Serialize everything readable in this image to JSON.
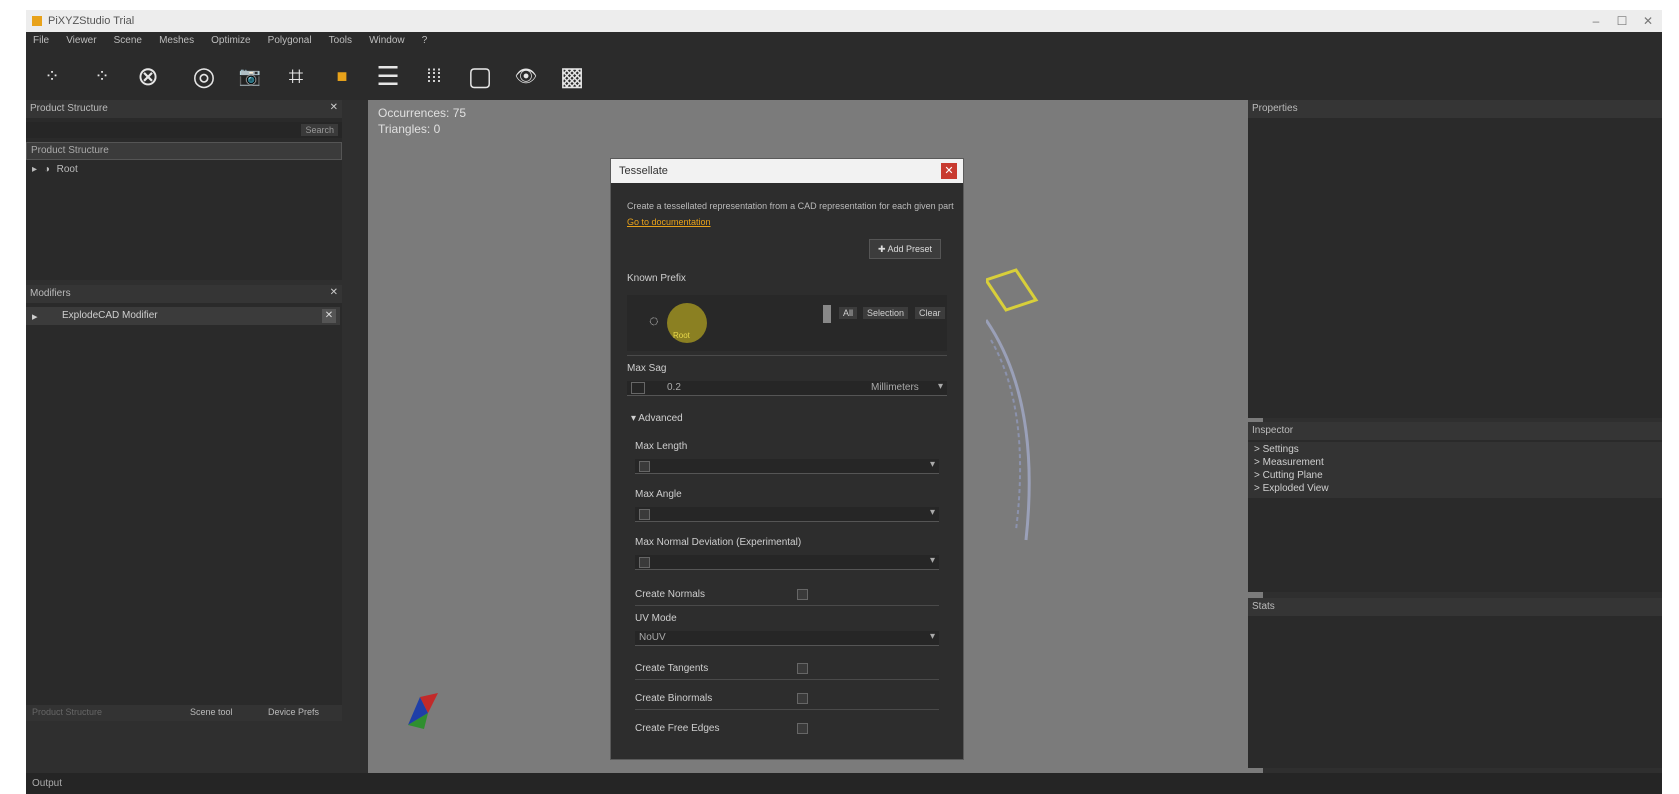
{
  "window": {
    "title": "PiXYZStudio Trial",
    "controls": [
      "‒",
      "☐",
      "✕"
    ]
  },
  "menu": [
    "File",
    "Viewer",
    "Scene",
    "Meshes",
    "Optimize",
    "Polygonal",
    "Tools",
    "Window",
    "?"
  ],
  "toolbar": [
    {
      "icon": "overlap-node-icon",
      "glyph": "⁘"
    },
    {
      "icon": "overlap-arrow-icon",
      "glyph": "⁘"
    },
    {
      "icon": "close-circle-icon",
      "glyph": "⊗"
    },
    {
      "icon": "fit-view-icon",
      "glyph": "◎"
    },
    {
      "icon": "camera-icon",
      "glyph": "📷"
    },
    {
      "icon": "crop-icon",
      "glyph": "⌗"
    },
    {
      "icon": "solid-square-icon",
      "glyph": "■"
    },
    {
      "icon": "lines-icon",
      "glyph": "☰"
    },
    {
      "icon": "grid-dots-icon",
      "glyph": "⁞⁞⁞"
    },
    {
      "icon": "square-outline-icon",
      "glyph": "▢"
    },
    {
      "icon": "eye-icon",
      "glyph": "👁"
    },
    {
      "icon": "checker-icon",
      "glyph": "▩"
    }
  ],
  "colors": {
    "accent": "#e8a21a",
    "close": "#c83a2f",
    "link": "#e8a21a"
  },
  "product_structure": {
    "title": "Product Structure",
    "search_label": "Search",
    "header": "Product Structure",
    "root": "Root"
  },
  "modifiers": {
    "title": "Modifiers",
    "item": "ExplodeCAD Modifier"
  },
  "left_bottom_tabs": [
    "Product Structure",
    "Scene tool",
    "Device Prefs"
  ],
  "viewport": {
    "occurrences": "Occurrences: 75",
    "triangles": "Triangles: 0"
  },
  "dialog": {
    "title": "Tessellate",
    "description": "Create a tessellated representation from a CAD representation for each given part",
    "doc_link": "Go to documentation",
    "add_preset": "Add Preset",
    "section_prefix": "Known Prefix",
    "thumb_label": "Root",
    "btn_a": "All",
    "btn_b": "Selection",
    "btn_c": "Clear",
    "max_sag": "Max Sag",
    "max_sag_value": "0.2",
    "max_sag_unit": "Millimeters",
    "advanced": "Advanced",
    "max_length": "Max Length",
    "max_angle": "Max Angle",
    "max_normal": "Max Normal Deviation (Experimental)",
    "create_normals": "Create Normals",
    "uv_mode": "UV Mode",
    "uv_mode_value": "NoUV",
    "create_tangents": "Create Tangents",
    "create_binormals": "Create Binormals",
    "create_free_edges": "Create Free Edges"
  },
  "right_panels": {
    "properties": "Properties",
    "inspector_title": "Inspector",
    "inspector_items": [
      "> Settings",
      "> Measurement",
      "> Cutting Plane",
      "> Exploded View"
    ],
    "stats": "Stats"
  },
  "status": {
    "label": "Output"
  }
}
